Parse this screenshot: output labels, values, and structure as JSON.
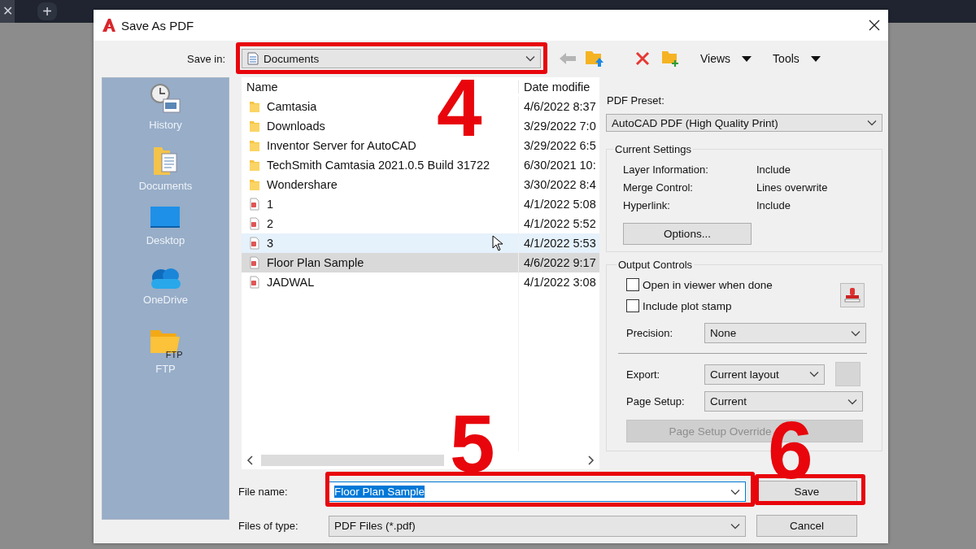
{
  "browser_tabs": {
    "close": "✕",
    "new_tab": "+"
  },
  "window": {
    "title": "Save As PDF"
  },
  "save_in": {
    "label": "Save in:",
    "value": "Documents"
  },
  "toolbar": {
    "views": "Views",
    "tools": "Tools"
  },
  "sidebar": {
    "items": [
      {
        "label": "History",
        "kind": "history"
      },
      {
        "label": "Documents",
        "kind": "documents"
      },
      {
        "label": "Desktop",
        "kind": "desktop"
      },
      {
        "label": "OneDrive",
        "kind": "onedrive"
      },
      {
        "label": "FTP",
        "kind": "ftp",
        "badge": "FTP"
      }
    ]
  },
  "file_list": {
    "columns": [
      "Name",
      "Date modifie"
    ],
    "rows": [
      {
        "kind": "folder",
        "name": "Camtasia",
        "date": "4/6/2022 8:37",
        "selected": false,
        "hovered": false
      },
      {
        "kind": "folder",
        "name": "Downloads",
        "date": "3/29/2022 7:0",
        "selected": false,
        "hovered": false
      },
      {
        "kind": "folder",
        "name": "Inventor Server for AutoCAD",
        "date": "3/29/2022 6:5",
        "selected": false,
        "hovered": false
      },
      {
        "kind": "folder",
        "name": "TechSmith Camtasia 2021.0.5 Build 31722",
        "date": "6/30/2021 10:",
        "selected": false,
        "hovered": false
      },
      {
        "kind": "folder",
        "name": "Wondershare",
        "date": "3/30/2022 8:4",
        "selected": false,
        "hovered": false
      },
      {
        "kind": "pdf",
        "name": "1",
        "date": "4/1/2022 5:08",
        "selected": false,
        "hovered": false
      },
      {
        "kind": "pdf",
        "name": "2",
        "date": "4/1/2022 5:52",
        "selected": false,
        "hovered": false
      },
      {
        "kind": "pdf",
        "name": "3",
        "date": "4/1/2022 5:53",
        "selected": false,
        "hovered": true
      },
      {
        "kind": "pdf",
        "name": "Floor Plan Sample",
        "date": "4/6/2022 9:17",
        "selected": true,
        "hovered": false
      },
      {
        "kind": "pdf",
        "name": "JADWAL",
        "date": "4/1/2022 3:08",
        "selected": false,
        "hovered": false
      }
    ]
  },
  "pdf_preset": {
    "label": "PDF Preset:",
    "value": "AutoCAD PDF (High Quality Print)"
  },
  "current_settings": {
    "title": "Current Settings",
    "rows": [
      {
        "label": "Layer Information:",
        "value": "Include"
      },
      {
        "label": "Merge Control:",
        "value": "Lines overwrite"
      },
      {
        "label": "Hyperlink:",
        "value": "Include"
      }
    ],
    "button": "Options..."
  },
  "output_controls": {
    "title": "Output Controls",
    "checkboxes": [
      {
        "label": "Open in viewer when done",
        "checked": false
      },
      {
        "label": "Include plot stamp",
        "checked": false
      }
    ],
    "precision": {
      "label": "Precision:",
      "value": "None"
    },
    "export": {
      "label": "Export:",
      "value": "Current layout"
    },
    "page_setup": {
      "label": "Page Setup:",
      "value": "Current"
    },
    "override_button": {
      "label": "Page Setup Override",
      "disabled": true
    }
  },
  "file_name": {
    "label": "File name:",
    "value": "Floor Plan Sample"
  },
  "file_type": {
    "label": "Files of type:",
    "value": "PDF Files (*.pdf)"
  },
  "buttons": [
    {
      "label": "Save"
    },
    {
      "label": "Cancel"
    }
  ],
  "annotations": [
    {
      "label": "4"
    },
    {
      "label": "5"
    },
    {
      "label": "6"
    }
  ]
}
